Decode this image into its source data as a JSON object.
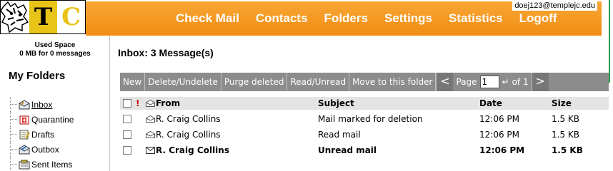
{
  "header": {
    "logo_letters": [
      "T",
      "C"
    ],
    "user_email": "doej123@templejc.edu",
    "nav": [
      "Check Mail",
      "Contacts",
      "Folders",
      "Settings",
      "Statistics",
      "Logoff"
    ],
    "colors": {
      "bar": "#f39a22",
      "accent": "#e8c318",
      "rule": "#2c9c4f"
    }
  },
  "sidebar": {
    "used_space_title": "Used Space",
    "used_space_value": "0 MB for 0 messages",
    "heading": "My Folders",
    "folders": [
      {
        "label": "Inbox",
        "icon": "inbox-icon",
        "underline": true
      },
      {
        "label": "Quarantine",
        "icon": "quarantine-icon"
      },
      {
        "label": "Drafts",
        "icon": "drafts-icon"
      },
      {
        "label": "Outbox",
        "icon": "outbox-icon"
      },
      {
        "label": "Sent Items",
        "icon": "sent-items-icon"
      }
    ]
  },
  "main": {
    "title": "Inbox: 3 Message(s)",
    "toolbar": {
      "buttons": [
        "New",
        "Delete/Undelete",
        "Purge deleted",
        "Read/Unread",
        "Move to this folder"
      ],
      "prev": "<",
      "next": ">",
      "page_label": "Page",
      "page_value": "1",
      "of_label": "of 1"
    },
    "columns": {
      "flag": "!",
      "from": "From",
      "subject": "Subject",
      "date": "Date",
      "size": "Size"
    },
    "messages": [
      {
        "from": "R. Craig Collins",
        "subject": "Mail marked for deletion",
        "date": "12:06 PM",
        "size": "1.5 KB",
        "state": "deleted"
      },
      {
        "from": "R. Craig Collins",
        "subject": "Read mail",
        "date": "12:06 PM",
        "size": "1.5 KB",
        "state": "read"
      },
      {
        "from": "R. Craig Collins",
        "subject": "Unread mail",
        "date": "12:06 PM",
        "size": "1.5 KB",
        "state": "unread"
      }
    ]
  }
}
